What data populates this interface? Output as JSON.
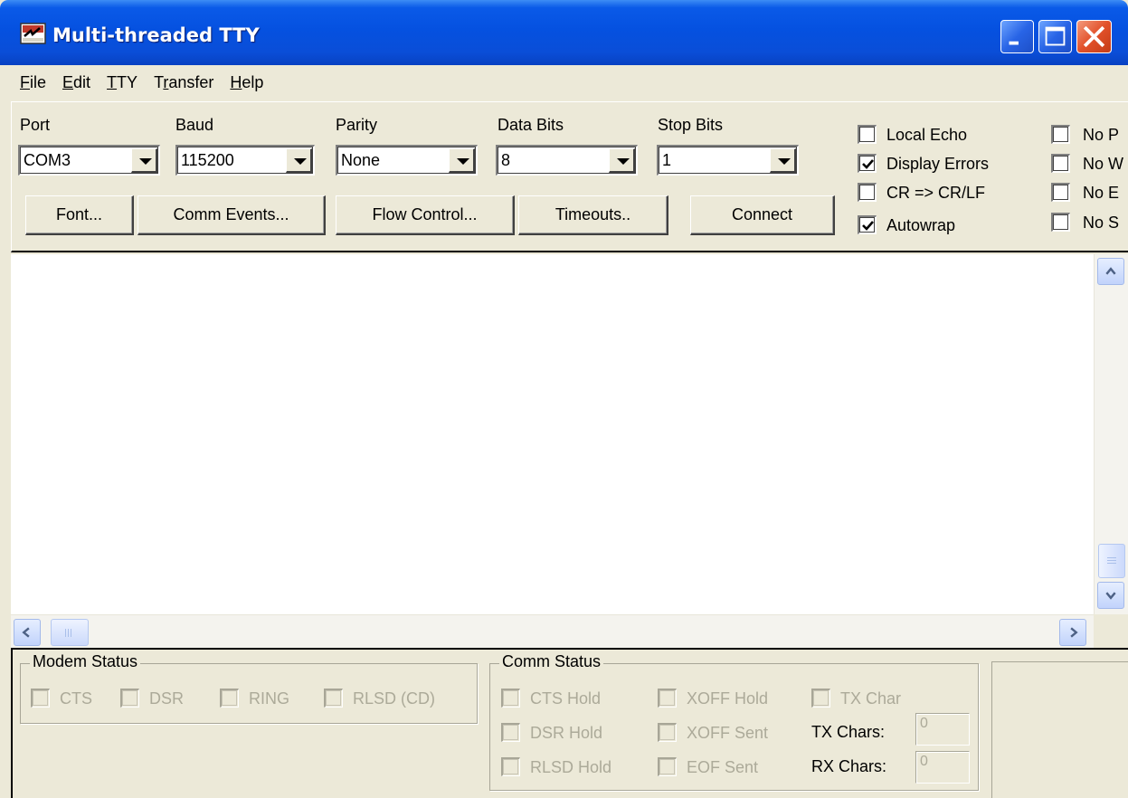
{
  "window": {
    "title": "Multi-threaded TTY",
    "icon": "tty-app-icon",
    "controls": [
      "minimize-icon",
      "maximize-icon",
      "close-icon"
    ],
    "accent": "#0551e0",
    "close_color": "#e2512a"
  },
  "menu": [
    {
      "label": "File",
      "mnemonic": "F",
      "rest": "ile"
    },
    {
      "label": "Edit",
      "mnemonic": "E",
      "rest": "dit"
    },
    {
      "label": "TTY",
      "mnemonic": "T",
      "rest": "TY"
    },
    {
      "label": "Transfer",
      "pre": "T",
      "mnemonic": "r",
      "rest": "ansfer"
    },
    {
      "label": "Help",
      "mnemonic": "H",
      "rest": "elp"
    }
  ],
  "settings": {
    "port": {
      "label": "Port",
      "value": "COM3"
    },
    "baud": {
      "label": "Baud",
      "value": "115200"
    },
    "parity": {
      "label": "Parity",
      "value": "None"
    },
    "data_bits": {
      "label": "Data Bits",
      "value": "8"
    },
    "stop_bits": {
      "label": "Stop Bits",
      "value": "1"
    }
  },
  "buttons": {
    "font": "Font...",
    "comm_events": "Comm Events...",
    "flow_control": "Flow Control...",
    "timeouts": "Timeouts..",
    "connect": "Connect"
  },
  "options": [
    {
      "label": "Local Echo",
      "checked": false
    },
    {
      "label": "Display Errors",
      "checked": true
    },
    {
      "label": "CR => CR/LF",
      "checked": false
    },
    {
      "label": "Autowrap",
      "checked": true
    }
  ],
  "options2": [
    {
      "label": "No P",
      "checked": false
    },
    {
      "label": "No W",
      "checked": false
    },
    {
      "label": "No E",
      "checked": false
    },
    {
      "label": "No S",
      "checked": false
    }
  ],
  "modem_status": {
    "title": "Modem Status",
    "items": [
      "CTS",
      "DSR",
      "RING",
      "RLSD (CD)"
    ]
  },
  "comm_status": {
    "title": "Comm Status",
    "items": [
      "CTS Hold",
      "XOFF Hold",
      "TX Char",
      "DSR Hold",
      "XOFF Sent",
      "RLSD Hold",
      "EOF Sent"
    ],
    "tx_label": "TX Chars:",
    "tx_value": "0",
    "rx_label": "RX Chars:",
    "rx_value": "0"
  },
  "terminal": {
    "content": ""
  }
}
